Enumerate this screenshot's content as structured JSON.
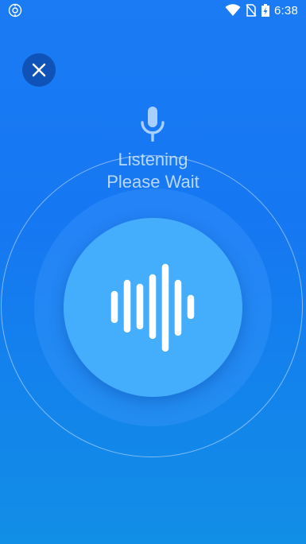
{
  "status_bar": {
    "time": "6:38",
    "left_icon": "settings-app-icon",
    "right_icons": [
      "wifi-icon",
      "no-sim-icon",
      "battery-charging-icon"
    ]
  },
  "voice": {
    "line1": "Listening",
    "line2": "Please Wait"
  },
  "icons": {
    "close": "close-icon",
    "mic": "microphone-icon",
    "waveform": "waveform-icon"
  },
  "colors": {
    "background_top": "#1a7bf5",
    "background_bottom": "#118ee6",
    "close_button": "#0f53b8",
    "mic_button": "#45aefc",
    "status_text": "#b8d8ff"
  }
}
